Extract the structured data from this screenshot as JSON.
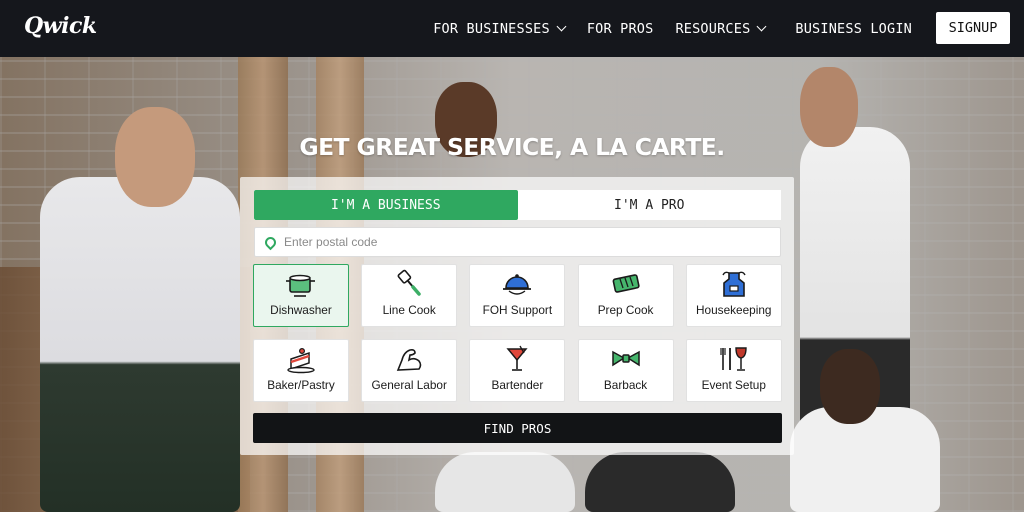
{
  "nav": {
    "logo": "Qwick",
    "links": [
      {
        "label": "FOR BUSINESSES",
        "dropdown": true
      },
      {
        "label": "FOR PROS",
        "dropdown": false
      },
      {
        "label": "RESOURCES",
        "dropdown": true
      },
      {
        "label": "BUSINESS LOGIN",
        "dropdown": false
      }
    ],
    "signup": "SIGNUP"
  },
  "hero": {
    "headline": "GET GREAT SERVICE, A LA CARTE."
  },
  "form": {
    "toggle": [
      {
        "label": "I'M A BUSINESS",
        "active": true
      },
      {
        "label": "I'M A PRO",
        "active": false
      }
    ],
    "postal_placeholder": "Enter postal code",
    "postal_value": "",
    "roles": [
      {
        "label": "Dishwasher",
        "icon": "dishwasher-pot-icon",
        "selected": true
      },
      {
        "label": "Line Cook",
        "icon": "spatula-icon",
        "selected": false
      },
      {
        "label": "FOH Support",
        "icon": "cloche-icon",
        "selected": false
      },
      {
        "label": "Prep Cook",
        "icon": "cutting-board-icon",
        "selected": false
      },
      {
        "label": "Housekeeping",
        "icon": "apron-icon",
        "selected": false
      },
      {
        "label": "Baker/Pastry",
        "icon": "cake-icon",
        "selected": false
      },
      {
        "label": "General Labor",
        "icon": "flexed-arm-icon",
        "selected": false
      },
      {
        "label": "Bartender",
        "icon": "cocktail-icon",
        "selected": false
      },
      {
        "label": "Barback",
        "icon": "bowtie-icon",
        "selected": false
      },
      {
        "label": "Event Setup",
        "icon": "utensils-wine-icon",
        "selected": false
      }
    ],
    "submit": "FIND PROS"
  },
  "colors": {
    "accent": "#2fa860",
    "nav_bg": "#15171c",
    "button_bg": "#121416"
  }
}
